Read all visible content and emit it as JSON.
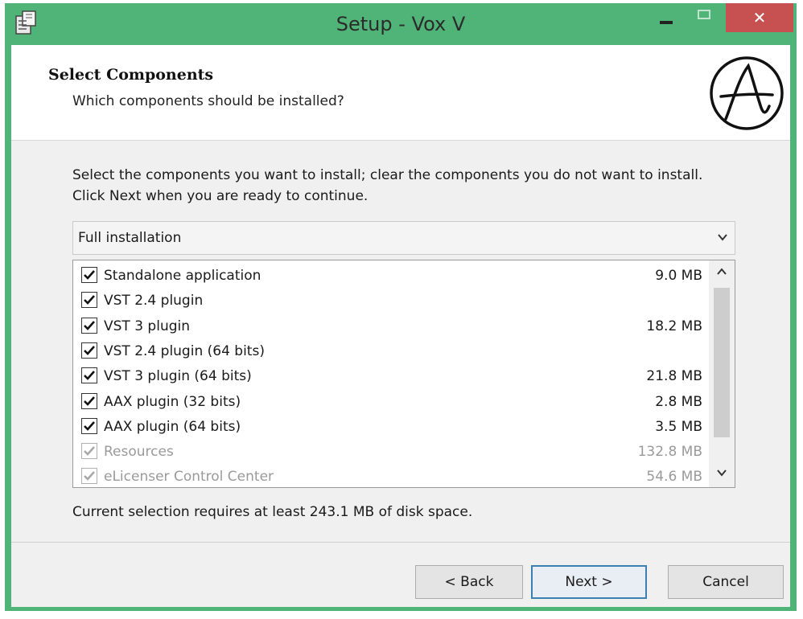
{
  "window": {
    "title": "Setup - Vox V",
    "close_glyph": "✕"
  },
  "header": {
    "title": "Select Components",
    "subtitle": "Which components should be installed?",
    "logo_icon": "circled-a-logo"
  },
  "content": {
    "instructions": "Select the components you want to install; clear the components you do not want to install. Click Next when you are ready to continue.",
    "install_type": {
      "selected": "Full installation"
    },
    "components": [
      {
        "label": "Standalone application",
        "size": "9.0 MB",
        "checked": true,
        "enabled": true
      },
      {
        "label": "VST 2.4 plugin",
        "size": "",
        "checked": true,
        "enabled": true
      },
      {
        "label": "VST 3 plugin",
        "size": "18.2 MB",
        "checked": true,
        "enabled": true
      },
      {
        "label": "VST 2.4 plugin (64 bits)",
        "size": "",
        "checked": true,
        "enabled": true
      },
      {
        "label": "VST 3 plugin (64 bits)",
        "size": "21.8 MB",
        "checked": true,
        "enabled": true
      },
      {
        "label": "AAX plugin (32 bits)",
        "size": "2.8 MB",
        "checked": true,
        "enabled": true
      },
      {
        "label": "AAX plugin (64 bits)",
        "size": "3.5 MB",
        "checked": true,
        "enabled": true
      },
      {
        "label": "Resources",
        "size": "132.8 MB",
        "checked": true,
        "enabled": false
      },
      {
        "label": "eLicenser Control Center",
        "size": "54.6 MB",
        "checked": true,
        "enabled": false
      }
    ],
    "disk_space": "Current selection requires at least 243.1 MB of disk space."
  },
  "buttons": {
    "back": "< Back",
    "next": "Next >",
    "cancel": "Cancel"
  },
  "colors": {
    "frame": "#50b377",
    "close": "#c75050",
    "default_button_border": "#3c7fb1"
  }
}
